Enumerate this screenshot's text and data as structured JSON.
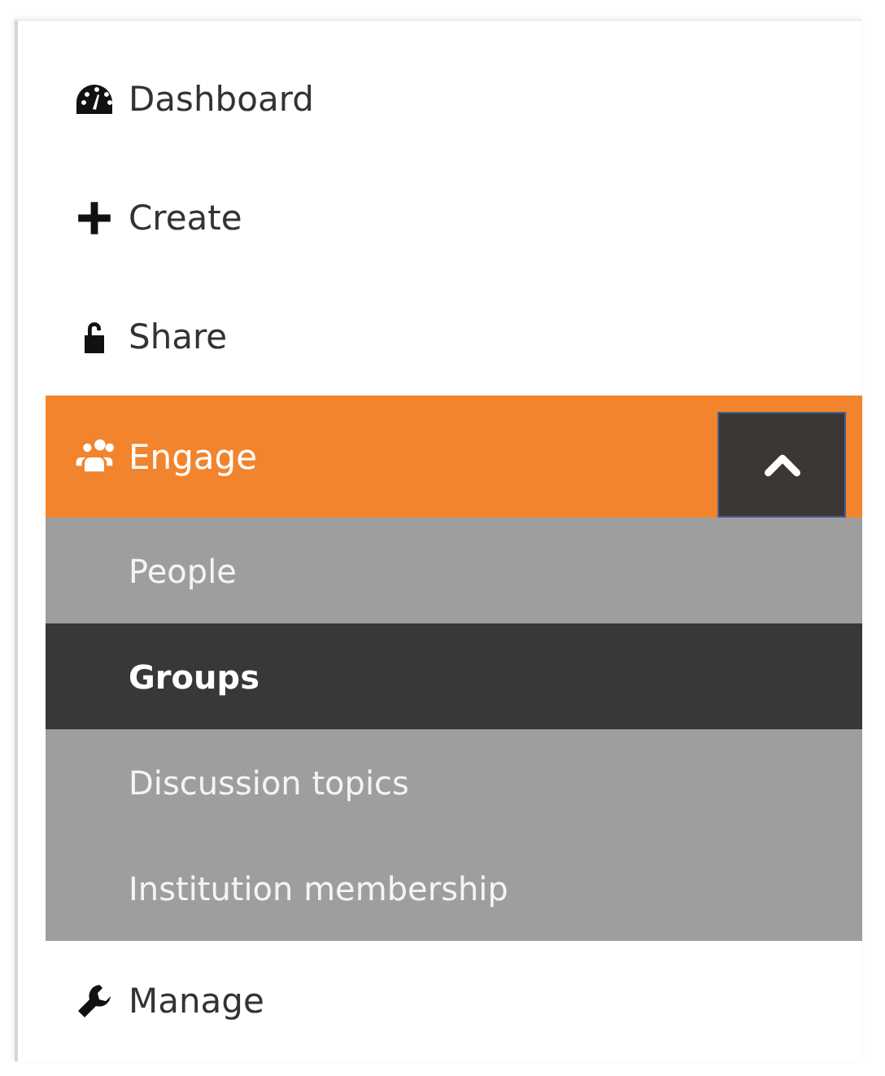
{
  "menu": [
    {
      "label": "Dashboard",
      "selected": false
    },
    {
      "label": "Create",
      "selected": false
    },
    {
      "label": "Share",
      "selected": false
    },
    {
      "label": "Engage",
      "selected": true,
      "expanded": true,
      "children": [
        {
          "label": "People",
          "selected": false
        },
        {
          "label": "Groups",
          "selected": true
        },
        {
          "label": "Discussion topics",
          "selected": false
        },
        {
          "label": "Institution membership",
          "selected": false
        }
      ]
    },
    {
      "label": "Manage",
      "selected": false
    }
  ]
}
